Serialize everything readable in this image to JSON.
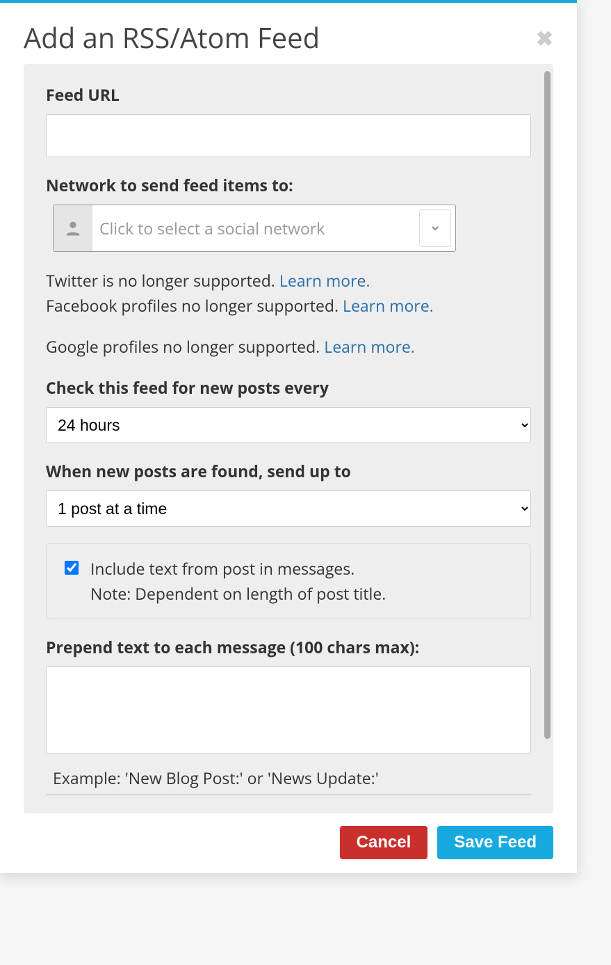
{
  "modal": {
    "title": "Add an RSS/Atom Feed"
  },
  "feedUrl": {
    "label": "Feed URL",
    "value": ""
  },
  "network": {
    "label": "Network to send feed items to:",
    "placeholder": "Click to select a social network"
  },
  "notes": {
    "twitter_text": "Twitter is no longer supported. ",
    "twitter_link": "Learn more.",
    "facebook_text": "Facebook profiles no longer supported. ",
    "facebook_link": "Learn more.",
    "google_text": "Google profiles no longer supported. ",
    "google_link": "Learn more."
  },
  "checkInterval": {
    "label": "Check this feed for new posts every",
    "selected": "24 hours"
  },
  "sendLimit": {
    "label": "When new posts are found, send up to",
    "selected": "1 post at a time"
  },
  "includeText": {
    "checked": true,
    "label": "Include text from post in messages.",
    "note": "Note: Dependent on length of post title."
  },
  "prepend": {
    "label": "Prepend text to each message (100 chars max):",
    "value": "",
    "example": "Example: 'New Blog Post:' or 'News Update:'"
  },
  "footer": {
    "cancel": "Cancel",
    "save": "Save Feed"
  }
}
